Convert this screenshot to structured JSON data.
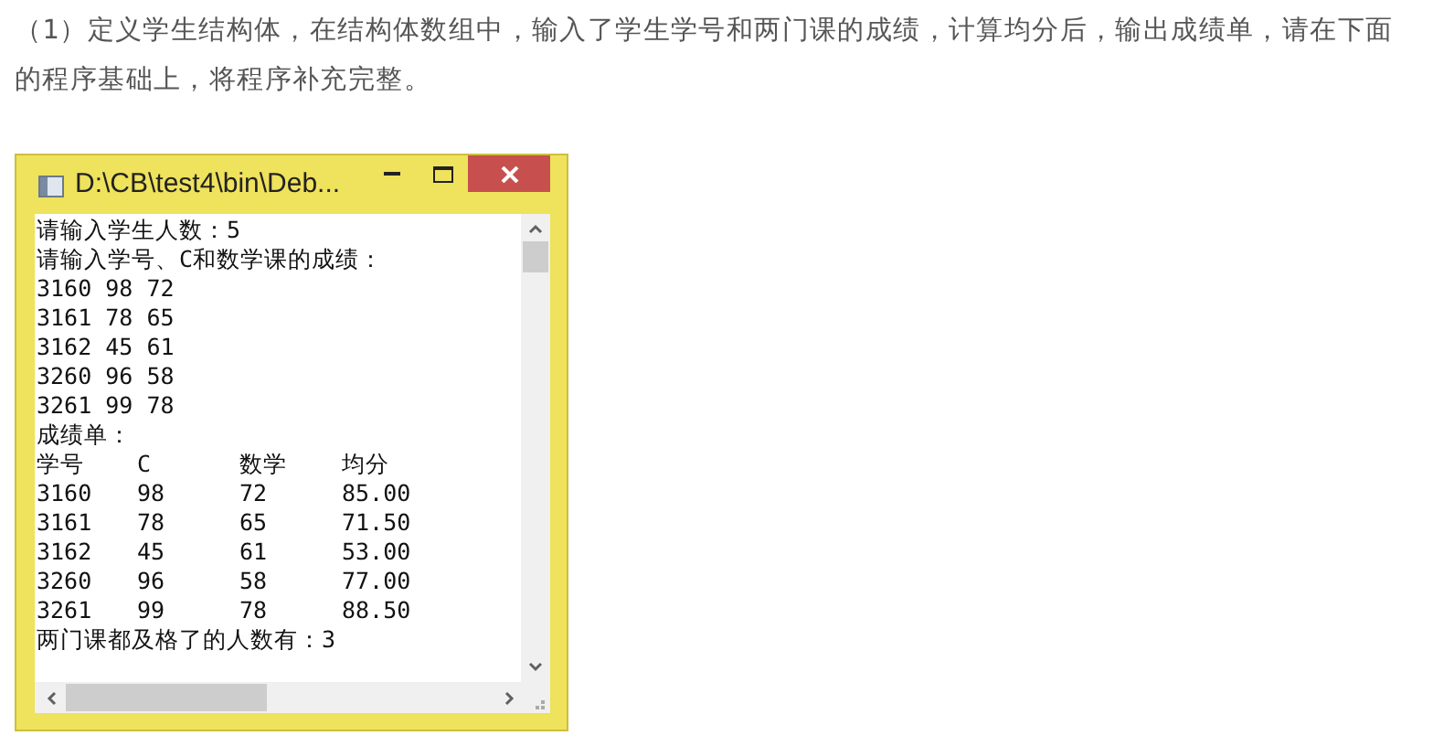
{
  "intro": "（1）定义学生结构体，在结构体数组中，输入了学生学号和两门课的成绩，计算均分后，输出成绩单，请在下面的程序基础上，将程序补充完整。",
  "window": {
    "title": "D:\\CB\\test4\\bin\\Deb...",
    "console": [
      {
        "kind": "text",
        "text": "请输入学生人数：5"
      },
      {
        "kind": "text",
        "text": "请输入学号、C和数学课的成绩："
      },
      {
        "kind": "text",
        "text": "3160 98 72"
      },
      {
        "kind": "text",
        "text": "3161 78 65"
      },
      {
        "kind": "text",
        "text": "3162 45 61"
      },
      {
        "kind": "text",
        "text": "3260 96 58"
      },
      {
        "kind": "text",
        "text": "3261 99 78"
      },
      {
        "kind": "text",
        "text": "成绩单："
      },
      {
        "kind": "row",
        "cells": [
          "学号",
          "C",
          "数学",
          "均分"
        ]
      },
      {
        "kind": "row",
        "cells": [
          "3160",
          "98",
          "72",
          "85.00"
        ]
      },
      {
        "kind": "row",
        "cells": [
          "3161",
          "78",
          "65",
          "71.50"
        ]
      },
      {
        "kind": "row",
        "cells": [
          "3162",
          "45",
          "61",
          "53.00"
        ]
      },
      {
        "kind": "row",
        "cells": [
          "3260",
          "96",
          "58",
          "77.00"
        ]
      },
      {
        "kind": "row",
        "cells": [
          "3261",
          "99",
          "78",
          "88.50"
        ]
      },
      {
        "kind": "text",
        "text": "两门课都及格了的人数有：3"
      }
    ]
  }
}
